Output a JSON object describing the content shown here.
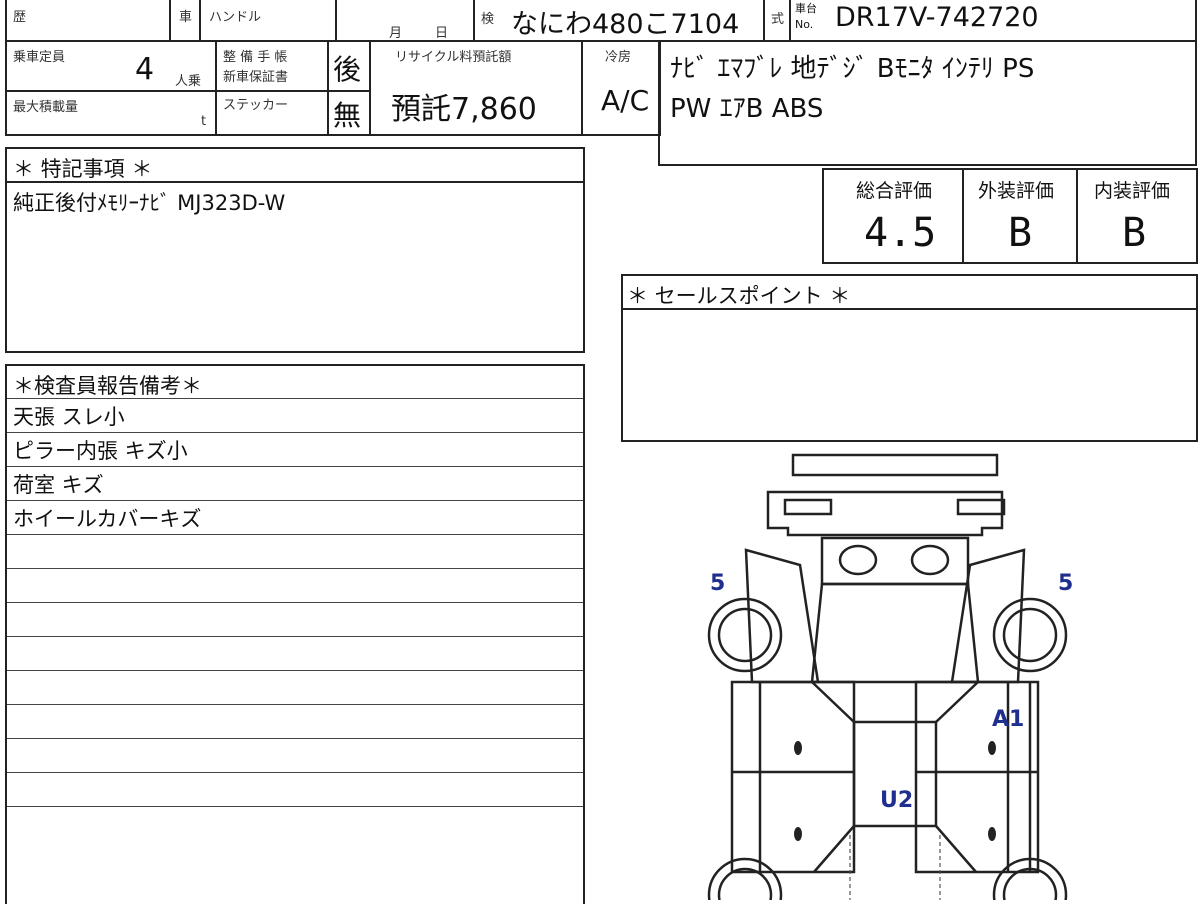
{
  "header": {
    "history_label": "歴",
    "car_label": "車",
    "handle_label": "ハンドル",
    "month_label": "月",
    "day_label": "日",
    "inspection_label": "検",
    "plate": "なにわ480こ7104",
    "type_label": "式",
    "chassis_label_top": "車台",
    "chassis_label_bottom": "No.",
    "chassis_no": "DR17V-742720"
  },
  "specs": {
    "capacity_label": "乗車定員",
    "capacity_value": "4",
    "capacity_unit": "人乗",
    "max_load_label": "最大積載量",
    "max_load_unit": "t",
    "maintenance_label_1": "整 備 手 帳",
    "maintenance_label_2": "新車保証書",
    "maintenance_value": "後",
    "sticker_label": "ステッカー",
    "sticker_value": "無",
    "recycle_label": "リサイクル料預託額",
    "recycle_value": "預託7,860",
    "cooler_label": "冷房",
    "cooler_value": "A/C",
    "equipment_line_1": "ﾅﾋﾞ ｴﾏﾌﾞﾚ 地ﾃﾞｼﾞ Bﾓﾆﾀ ｲﾝﾃﾘ PS",
    "equipment_line_2": "PW ｴｱB ABS"
  },
  "special_notes": {
    "title": "＊ 特記事項 ＊",
    "text": "純正後付ﾒﾓﾘｰﾅﾋﾞ MJ323D-W"
  },
  "ratings": {
    "overall_label": "総合評価",
    "overall_value": "4.5",
    "exterior_label": "外装評価",
    "exterior_value": "B",
    "interior_label": "内装評価",
    "interior_value": "B"
  },
  "sales_point": {
    "title": "＊ セールスポイント ＊"
  },
  "inspector_report": {
    "title": "＊検査員報告備考＊",
    "rows": [
      "天張 スレ小",
      "ピラー内張 キズ小",
      "荷室 キズ",
      "ホイールカバーキズ",
      "",
      "",
      "",
      "",
      "",
      "",
      "",
      "",
      ""
    ]
  },
  "diagram": {
    "marks": {
      "left_tire": "5",
      "right_tire": "5",
      "right_panel": "A1",
      "center": "U2"
    },
    "mark_color": "#1f2f8f"
  }
}
